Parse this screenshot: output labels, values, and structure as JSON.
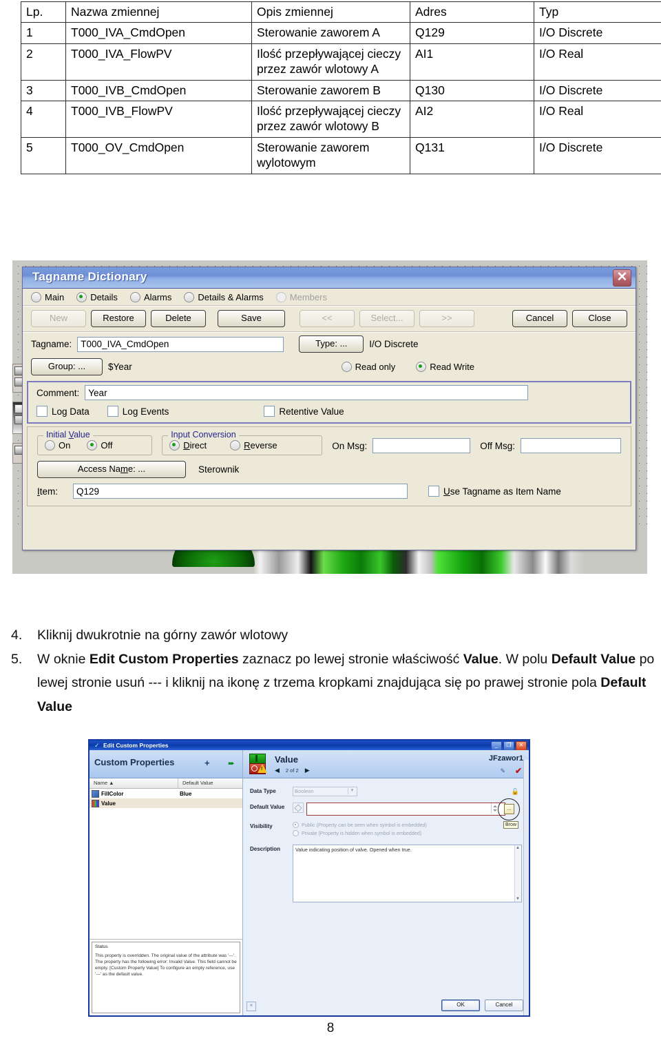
{
  "table": {
    "headers": [
      "Lp.",
      "Nazwa zmiennej",
      "Opis zmiennej",
      "Adres",
      "Typ"
    ],
    "rows": [
      {
        "lp": "1",
        "name": "T000_IVA_CmdOpen",
        "desc": "Sterowanie zaworem A",
        "addr": "Q129",
        "type": "I/O Discrete"
      },
      {
        "lp": "2",
        "name": "T000_IVA_FlowPV",
        "desc": "Ilość przepływającej cieczy przez zawór wlotowy A",
        "addr": "AI1",
        "type": "I/O Real"
      },
      {
        "lp": "3",
        "name": "T000_IVB_CmdOpen",
        "desc": "Sterowanie zaworem B",
        "addr": "Q130",
        "type": "I/O Discrete"
      },
      {
        "lp": "4",
        "name": "T000_IVB_FlowPV",
        "desc": "Ilość przepływającej cieczy przez zawór wlotowy B",
        "addr": "AI2",
        "type": "I/O Real"
      },
      {
        "lp": "5",
        "name": "T000_OV_CmdOpen",
        "desc": "Sterowanie zaworem wylotowym",
        "addr": "Q131",
        "type": "I/O Discrete"
      }
    ]
  },
  "tagname_dialog": {
    "title": "Tagname Dictionary",
    "close_glyph": "✕",
    "view_radios": [
      {
        "label": "Main",
        "selected": false,
        "disabled": false
      },
      {
        "label": "Details",
        "selected": true,
        "disabled": false
      },
      {
        "label": "Alarms",
        "selected": false,
        "disabled": false
      },
      {
        "label": "Details & Alarms",
        "selected": false,
        "disabled": false
      },
      {
        "label": "Members",
        "selected": false,
        "disabled": true
      }
    ],
    "buttons": {
      "new": "New",
      "restore": "Restore",
      "delete": "Delete",
      "save": "Save",
      "prev": "<<",
      "select": "Select...",
      "next": ">>",
      "cancel": "Cancel",
      "close": "Close"
    },
    "tagname_label": "Tagname:",
    "tagname_value": "T000_IVA_CmdOpen",
    "type_button": "Type: ...",
    "type_value": "I/O Discrete",
    "group_button": "Group: ...",
    "group_value": "$Year",
    "access_radios": [
      {
        "label": "Read only",
        "selected": false
      },
      {
        "label": "Read Write",
        "selected": true
      }
    ],
    "comment_label": "Comment:",
    "comment_value": "Year",
    "checkboxes": [
      {
        "label": "Log Data",
        "checked": false
      },
      {
        "label": "Log Events",
        "checked": false
      },
      {
        "label": "Retentive Value",
        "checked": false
      }
    ],
    "initial_value": {
      "caption": "Initial Value",
      "options": [
        {
          "label": "On",
          "selected": false
        },
        {
          "label": "Off",
          "selected": true
        }
      ]
    },
    "input_conversion": {
      "caption": "Input Conversion",
      "options": [
        {
          "label": "Direct",
          "selected": true
        },
        {
          "label": "Reverse",
          "selected": false
        }
      ]
    },
    "on_msg_label": "On Msg:",
    "on_msg_value": "",
    "off_msg_label": "Off Msg:",
    "off_msg_value": "",
    "access_name_button": "Access Name: ...",
    "access_name_value": "Sterownik",
    "item_label": "Item:",
    "item_value": "Q129",
    "use_tagname_checkbox": {
      "label": "Use Tagname as Item Name",
      "checked": false
    }
  },
  "instructions": [
    {
      "num": "4.",
      "segments": [
        {
          "text": "Kliknij dwukrotnie na górny zawór wlotowy",
          "bold": false
        }
      ]
    },
    {
      "num": "5.",
      "segments": [
        {
          "text": "W oknie ",
          "bold": false
        },
        {
          "text": "Edit Custom Properties",
          "bold": true
        },
        {
          "text": " zaznacz po lewej stronie właściwość ",
          "bold": false
        },
        {
          "text": "Value",
          "bold": true
        },
        {
          "text": ". W polu ",
          "bold": false
        },
        {
          "text": "Default Value",
          "bold": true
        },
        {
          "text": " po lewej stronie usuń --- i kliknij na ikonę z trzema kropkami znajdująca się po prawej stronie pola ",
          "bold": false
        },
        {
          "text": "Default Value",
          "bold": true
        }
      ]
    }
  ],
  "ecp_dialog": {
    "window_title": "Edit Custom Properties",
    "window_buttons": {
      "minimize": "_",
      "maximize": "❐",
      "close": "✕"
    },
    "left": {
      "header": "Custom Properties",
      "add_icon": "+",
      "export_icon": "➨",
      "columns": [
        "Name  ▲",
        "Default Value"
      ],
      "rows": [
        {
          "name": "FillColor",
          "default": "Blue",
          "selected": false
        },
        {
          "name": "Value",
          "default": "",
          "selected": true
        }
      ],
      "status_label": "Status",
      "status_text": "This property is overridden.  The original value of the attribute was '---'.  The property has the following error: Invalid Value. This field cannot be empty. [Custom Property Value]  To configure an empty reference, use '---' as the default value."
    },
    "right": {
      "property_name": "Value",
      "symbol_name": "JFzawor1",
      "nav_prev": "◀",
      "nav_next": "▶",
      "nav_counter": "2 of 2",
      "eraser_icon": "✎",
      "check_icon": "✔",
      "data_type_label": "Data Type",
      "data_type_value": "Boolean",
      "default_value_label": "Default Value",
      "default_value": "",
      "ellipsis_button": "...",
      "browse_tooltip": "Brow",
      "visibility_label": "Visibility",
      "visibility_options": [
        {
          "label": "Public (Property can be seen when symbol is embedded)",
          "selected": true
        },
        {
          "label": "Private (Property is hidden when symbol is embedded)",
          "selected": false
        }
      ],
      "description_label": "Description",
      "description_text": "Value indicating position of valve.  Opened when true.",
      "ok_button": "OK",
      "cancel_button": "Cancel",
      "collapse_icon": "«"
    }
  },
  "page_number": "8"
}
